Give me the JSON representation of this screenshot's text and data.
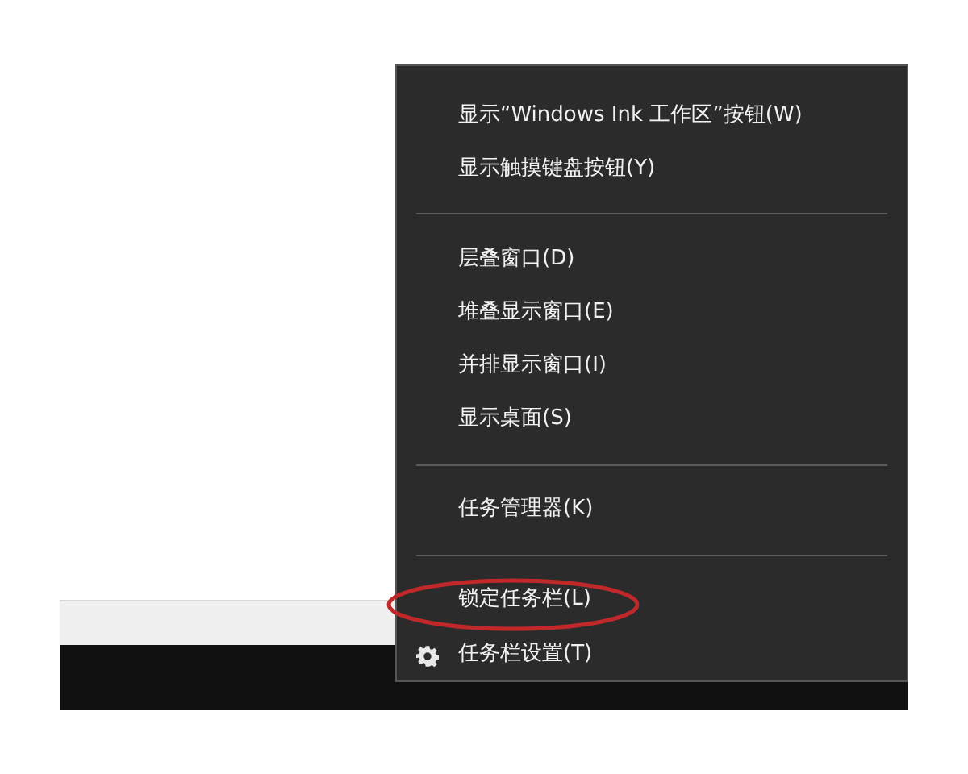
{
  "menu": {
    "items": [
      {
        "kind": "item",
        "label": "显示“Windows Ink 工作区”按钮(W)"
      },
      {
        "kind": "item",
        "label": "显示触摸键盘按钮(Y)"
      },
      {
        "kind": "separator"
      },
      {
        "kind": "item",
        "label": "层叠窗口(D)"
      },
      {
        "kind": "item",
        "label": "堆叠显示窗口(E)"
      },
      {
        "kind": "item",
        "label": "并排显示窗口(I)"
      },
      {
        "kind": "item",
        "label": "显示桌面(S)"
      },
      {
        "kind": "separator"
      },
      {
        "kind": "item",
        "label": "任务管理器(K)"
      },
      {
        "kind": "separator"
      },
      {
        "kind": "item",
        "label": "锁定任务栏(L)",
        "circled": true
      },
      {
        "kind": "settings",
        "label": "任务栏设置(T)"
      }
    ]
  }
}
